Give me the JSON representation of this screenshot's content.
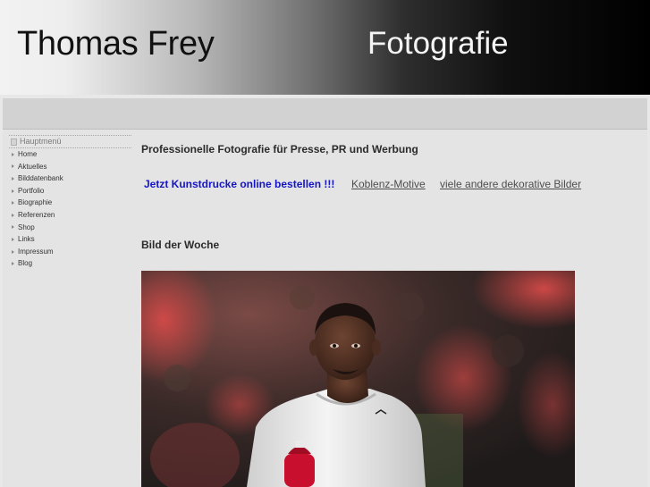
{
  "header": {
    "site_name": "Thomas Frey",
    "site_tagline": "Fotografie"
  },
  "menu": {
    "title": "Hauptmenü",
    "items": [
      {
        "label": "Home"
      },
      {
        "label": "Aktuelles"
      },
      {
        "label": "Bilddatenbank"
      },
      {
        "label": "Portfolio"
      },
      {
        "label": "Biographie"
      },
      {
        "label": "Referenzen"
      },
      {
        "label": "Shop"
      },
      {
        "label": "Links"
      },
      {
        "label": "Impressum"
      },
      {
        "label": "Blog"
      }
    ]
  },
  "main": {
    "heading": "Professionelle Fotografie für Presse, PR und Werbung",
    "links": {
      "order_prints": "Jetzt Kunstdrucke online bestellen !!!",
      "koblenz": "Koblenz-Motive",
      "other": "viele andere dekorative Bilder"
    },
    "photo_heading": "Bild der Woche"
  },
  "colors": {
    "order_link": "#1515c8",
    "plain_link": "#4d4d4d",
    "jersey_red": "#c8102e",
    "shirt": "#f2f2f2"
  }
}
